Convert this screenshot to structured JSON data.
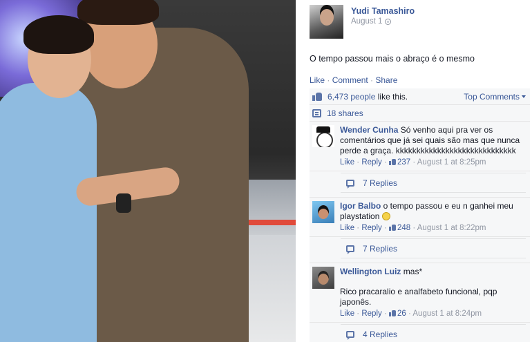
{
  "post": {
    "author_name": "Yudi Tamashiro",
    "date": "August 1",
    "text": "O tempo passou mais o abraço é o mesmo"
  },
  "actions": {
    "like": "Like",
    "sep1": " · ",
    "comment": "Comment",
    "sep2": " · ",
    "share": "Share"
  },
  "ufi": {
    "likes_count": "6,473 people",
    "likes_suffix": " like this.",
    "sort_label": "Top Comments",
    "shares": "18 shares"
  },
  "comments": [
    {
      "name": "Wender Cunha",
      "text": " Só venho aqui pra ver os comentários que já sei quais são mas que nunca perde a graça. kkkkkkkkkkkkkkkkkkkkkkkkkkkkk",
      "like": "Like",
      "reply": "Reply",
      "likes": "237",
      "time": "August 1 at 8:25pm",
      "replies": "7 Replies"
    },
    {
      "name": "Igor Balbo",
      "text": " o tempo passou e eu n ganhei meu playstation ",
      "like": "Like",
      "reply": "Reply",
      "likes": "248",
      "time": "August 1 at 8:22pm",
      "replies": "7 Replies"
    },
    {
      "name": "Wellington Luiz",
      "text": " mas*",
      "text2": "Rico pracaralio e analfabeto funcional, pqp japonês.",
      "like": "Like",
      "reply": "Reply",
      "likes": "26",
      "time": "August 1 at 8:24pm",
      "replies": "4 Replies"
    }
  ],
  "icons": [
    "globe-icon",
    "like-icon",
    "share-icon",
    "reply-icon",
    "smiley-icon"
  ],
  "colors": {
    "link": "#3b5998",
    "muted": "#9197a3",
    "panel_bg": "#f6f7f8"
  }
}
